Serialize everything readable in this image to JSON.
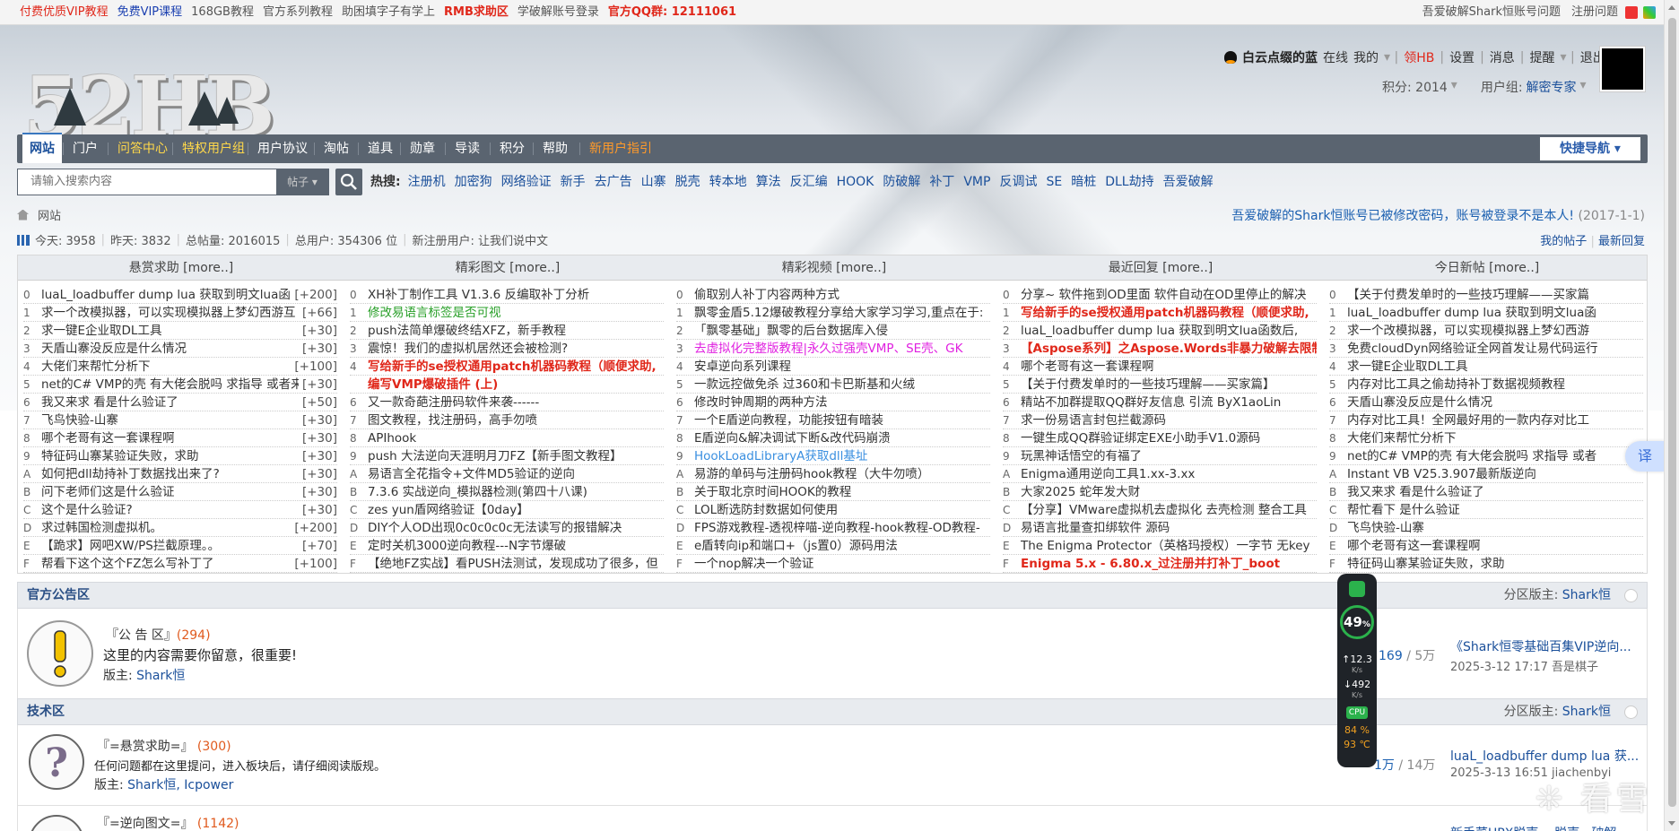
{
  "topbar": {
    "left": [
      {
        "t": "付费优质VIP教程",
        "c": "#e0271a"
      },
      {
        "t": "免费VIP课程",
        "c": "#1a3fb0"
      },
      {
        "t": "168GB教程",
        "c": "#555"
      },
      {
        "t": "官方系列教程",
        "c": "#555"
      },
      {
        "t": "助困填字子有学上",
        "c": "#555"
      },
      {
        "t": "RMB求助区",
        "c": "#e0271a",
        "b": true
      },
      {
        "t": "学破解账号登录",
        "c": "#555"
      },
      {
        "t": "官方QQ群:  12111061",
        "c": "#e0271a",
        "b": true
      }
    ],
    "right": [
      "吾爱破解Shark恒账号问题",
      "注册问题"
    ]
  },
  "logo_text": "52HB",
  "user": {
    "name": "白云点缀的蓝",
    "status": "在线",
    "menu": [
      "我的",
      "领HB",
      "设置",
      "消息",
      "提醒",
      "退出"
    ],
    "points_label": "积分: 2014",
    "group_label": "用户组:",
    "group_value": "解密专家"
  },
  "nav": {
    "items": [
      {
        "t": "网站",
        "active": true
      },
      {
        "t": "门户"
      },
      {
        "t": "问答中心",
        "c": "#ffd84a"
      },
      {
        "t": "特权用户组",
        "c": "#ffd84a"
      },
      {
        "t": "用户协议"
      },
      {
        "t": "淘帖"
      },
      {
        "t": "道具"
      },
      {
        "t": "勋章"
      },
      {
        "t": "导读"
      },
      {
        "t": "积分"
      },
      {
        "t": "帮助"
      },
      {
        "t": "新用户指引",
        "c": "#ff9a2a"
      }
    ],
    "quick_label": "快捷导航"
  },
  "search": {
    "placeholder": "请输入搜索内容",
    "select_label": "帖子",
    "hot_label": "热搜:",
    "hot_words": [
      "注册机",
      "加密狗",
      "网络验证",
      "新手",
      "去广告",
      "山寨",
      "脱壳",
      "转本地",
      "算法",
      "反汇编",
      "HOOK",
      "防破解",
      "补丁",
      "VMP",
      "反调试",
      "SE",
      "暗桩",
      "DLL劫持",
      "吾爱破解"
    ]
  },
  "crumb": "网站",
  "notice": {
    "text": "吾爱破解的Shark恒账号已被修改密码，账号被登录不是本人!",
    "date": "(2017-1-1)"
  },
  "stats": {
    "today": "今天: 3958",
    "yesterday": "昨天: 3832",
    "total": "总帖量: 2016015",
    "users": "总用户: 354306 位",
    "newest": "新注册用户: 让我们说中文"
  },
  "stats_links": [
    "我的帖子",
    "最新回复"
  ],
  "columns": [
    {
      "title": "悬赏求助 [more..]",
      "items": [
        {
          "n": "0",
          "t": "luaL_loadbuffer dump lua 获取到明文lua函",
          "p": "[+200]"
        },
        {
          "n": "1",
          "t": "求一个改模拟器，可以实现模拟器上梦幻西游互",
          "p": "[+66]"
        },
        {
          "n": "2",
          "t": "求一键E企业取DL工具",
          "p": "[+30]"
        },
        {
          "n": "3",
          "t": "天盾山寨没反应是什么情况",
          "p": "[+30]"
        },
        {
          "n": "4",
          "t": "大佬们来帮忙分析下",
          "p": "[+100]"
        },
        {
          "n": "5",
          "t": "net的C# VMP的壳 有大佬会脱吗 求指导 或者来",
          "p": "[+30]"
        },
        {
          "n": "6",
          "t": "我又来求 看是什么验证了",
          "p": "[+50]"
        },
        {
          "n": "7",
          "t": "飞鸟快验-山寨",
          "p": "[+30]"
        },
        {
          "n": "8",
          "t": "哪个老哥有这一套课程啊",
          "p": "[+30]"
        },
        {
          "n": "9",
          "t": "特征码山寨某验证失败，求助",
          "p": "[+30]"
        },
        {
          "n": "A",
          "t": "如何把dll劫持补丁数据找出来了?",
          "p": "[+30]"
        },
        {
          "n": "B",
          "t": "问下老师们这是什么验证",
          "p": "[+30]"
        },
        {
          "n": "C",
          "t": "这个是什么验证?",
          "p": "[+30]"
        },
        {
          "n": "D",
          "t": "求过韩国检测虚拟机。",
          "p": "[+200]"
        },
        {
          "n": "E",
          "t": "【跪求】网吧XW/PS拦截原理。。",
          "p": "[+70]"
        },
        {
          "n": "F",
          "t": "帮看下这个这个FZ怎么写补丁了",
          "p": "[+100]"
        }
      ]
    },
    {
      "title": "精彩图文 [more..]",
      "items": [
        {
          "n": "0",
          "t": "XH补丁制作工具 V1.3.6 反编取补丁分析"
        },
        {
          "n": "1",
          "t": "修改易语言标签是否可视",
          "c": "#2aa02a"
        },
        {
          "n": "2",
          "t": "push法简单爆破终结XFZ，新手教程"
        },
        {
          "n": "3",
          "t": "震惊！我们的虚拟机居然还会被检测?"
        },
        {
          "n": "4",
          "t": "写给新手的se授权通用patch机器码教程（顺便求助,",
          "c": "#e0271a",
          "b": true
        },
        {
          "n": "",
          "t": "编写VMP爆破插件 (上)",
          "c": "#e0271a",
          "b": true
        },
        {
          "n": "6",
          "t": "又一款奇葩注册码软件来袭------"
        },
        {
          "n": "7",
          "t": "图文教程，找注册码，高手勿喷"
        },
        {
          "n": "8",
          "t": "APIhook"
        },
        {
          "n": "9",
          "t": "push 大法逆向天涯明月刀FZ【新手图文教程】"
        },
        {
          "n": "A",
          "t": "易语言全花指令+文件MD5验证的逆向"
        },
        {
          "n": "B",
          "t": "7.3.6 实战逆向_模拟器检测(第四十八课)"
        },
        {
          "n": "C",
          "t": "zes yun盾网络验证【0day】"
        },
        {
          "n": "D",
          "t": "DIY个人OD出现0c0c0c0c无法读写的报错解决"
        },
        {
          "n": "E",
          "t": "定时关机3000逆向教程---N字节爆破"
        },
        {
          "n": "F",
          "t": "【绝地FZ实战】看PUSH法测试，发现成功了很多，但"
        }
      ]
    },
    {
      "title": "精彩视频 [more..]",
      "items": [
        {
          "n": "0",
          "t": "偷取别人补丁内容两种方式"
        },
        {
          "n": "1",
          "t": "飘零金盾5.12爆破教程分享给大家学习学习,重点在于:"
        },
        {
          "n": "2",
          "t": "「飘零基础」飘零的后台数据库入侵"
        },
        {
          "n": "3",
          "t": "去虚拟化完整版教程|永久过强壳VMP、SE壳、GK",
          "c": "#e020e0"
        },
        {
          "n": "4",
          "t": "安卓逆向系列课程"
        },
        {
          "n": "5",
          "t": "一款远控做免杀 过360和卡巴斯基和火绒"
        },
        {
          "n": "6",
          "t": "修改时钟周期的两种方法"
        },
        {
          "n": "7",
          "t": "一个E盾逆向教程，功能按钮有暗装"
        },
        {
          "n": "8",
          "t": "E盾逆向&解决调试下断&改代码崩溃"
        },
        {
          "n": "9",
          "t": "HookLoadLibraryA获取dll基址",
          "c": "#3a8fe0"
        },
        {
          "n": "A",
          "t": "易游的单码与注册码hook教程（大牛勿喷）"
        },
        {
          "n": "B",
          "t": "关于取北京时间HOOK的教程"
        },
        {
          "n": "C",
          "t": "LOL断选防封数据如何使用"
        },
        {
          "n": "D",
          "t": "FPS游戏教程-透视梓喵-逆向教程-hook教程-OD教程-"
        },
        {
          "n": "E",
          "t": "e盾转向ip和端口+（js置0）源码用法"
        },
        {
          "n": "F",
          "t": "一个nop解决一个验证"
        }
      ]
    },
    {
      "title": "最近回复 [more..]",
      "items": [
        {
          "n": "0",
          "t": "分享~ 软件拖到OD里面 软件自动在OD里停止的解决"
        },
        {
          "n": "1",
          "t": "写给新手的se授权通用patch机器码教程（顺便求助,",
          "c": "#e0271a",
          "b": true
        },
        {
          "n": "2",
          "t": "luaL_loadbuffer dump lua 获取到明文lua函数后,"
        },
        {
          "n": "3",
          "t": "【Aspose系列】之Aspose.Words非暴力破解去限制",
          "c": "#e0271a",
          "b": true
        },
        {
          "n": "4",
          "t": "哪个老哥有这一套课程啊"
        },
        {
          "n": "5",
          "t": "【关于付费发单时的一些技巧理解——买家篇】"
        },
        {
          "n": "6",
          "t": "精站不加群提取QQ群好友信息 引流 ByX1aoLin"
        },
        {
          "n": "7",
          "t": "求一份易语言封包拦截源码"
        },
        {
          "n": "8",
          "t": "一键生成QQ群验证绑定EXE小助手V1.0源码"
        },
        {
          "n": "9",
          "t": "玩黑神话悟空的有福了"
        },
        {
          "n": "A",
          "t": "Enigma通用逆向工具1.xx-3.xx"
        },
        {
          "n": "B",
          "t": "大家2025 蛇年发大财"
        },
        {
          "n": "C",
          "t": "【分享】VMware虚拟机去虚拟化 去壳检测 整合工具"
        },
        {
          "n": "D",
          "t": "易语言批量查扣绑软件 源码"
        },
        {
          "n": "E",
          "t": "The Enigma Protector（英格玛授权）一字节 无key"
        },
        {
          "n": "F",
          "t": "Enigma 5.x - 6.80.x_过注册并打补丁_boot",
          "c": "#e0271a",
          "b": true
        }
      ]
    },
    {
      "title": "今日新帖 [more..]",
      "items": [
        {
          "n": "0",
          "t": "【关于付费发单时的一些技巧理解——买家篇"
        },
        {
          "n": "1",
          "t": "luaL_loadbuffer dump lua 获取到明文lua函"
        },
        {
          "n": "2",
          "t": "求一个改模拟器，可以实现模拟器上梦幻西游"
        },
        {
          "n": "3",
          "t": "免费cloudDyn网络验证全网首发让易代码运行"
        },
        {
          "n": "4",
          "t": "求一键E企业取DL工具"
        },
        {
          "n": "5",
          "t": "内存对比工具之偷劫持补丁数据视频教程"
        },
        {
          "n": "6",
          "t": "天盾山寨没反应是什么情况"
        },
        {
          "n": "7",
          "t": "内存对比工具！全网最好用的一款内存对比工"
        },
        {
          "n": "8",
          "t": "大佬们来帮忙分析下"
        },
        {
          "n": "9",
          "t": "net的C# VMP的壳 有大佬会脱吗 求指导 或者"
        },
        {
          "n": "A",
          "t": "Instant VB V25.3.907最新版逆向"
        },
        {
          "n": "B",
          "t": "我又来求 看是什么验证了"
        },
        {
          "n": "C",
          "t": "帮忙看下 是什么验证"
        },
        {
          "n": "D",
          "t": "飞鸟快验-山寨"
        },
        {
          "n": "E",
          "t": "哪个老哥有这一套课程啊"
        },
        {
          "n": "F",
          "t": "特征码山寨某验证失败，求助"
        }
      ]
    }
  ],
  "sections": [
    {
      "title": "官方公告区",
      "mod_label": "分区版主:",
      "mod": "Shark恒"
    },
    {
      "title": "技术区",
      "mod_label": "分区版主:",
      "mod": "Shark恒"
    }
  ],
  "forums": [
    {
      "name": "『公 告 区』",
      "count": "(294)",
      "desc": "这里的内容需要你留意，很重要!",
      "mod_label": "版主:",
      "mod": "Shark恒",
      "threads": "169",
      "posts": "/ 5万",
      "last_title": "《Shark恒零基础百集VIP逆向...",
      "last_meta": "2025-3-12 17:17 吾是棋子"
    },
    {
      "name": "『=悬赏求助=』",
      "count": "(300)",
      "desc": "任何问题都在这里提问，进入板块后，请仔细阅读版规。",
      "mod_label": "版主:",
      "mod": "Shark恒, Icpower",
      "threads": "1万",
      "posts": "/ 14万",
      "last_title": "luaL_loadbuffer dump lua 获...",
      "last_meta": "2025-3-13 16:51 jiachenbyi"
    },
    {
      "name": "『=逆向图文=』",
      "count": "(1142)",
      "last_title": "新手菜UPX脱壳... 脱壳 · 破解"
    }
  ],
  "widget": {
    "percent": "49",
    "percent_unit": "%",
    "up": "12.3",
    "down": "492",
    "speed_unit": "K/s",
    "cpu_label": "CPU",
    "cpu": "84 %",
    "temp": "93 ℃"
  },
  "translate_label": "译",
  "watermark": "看雪"
}
